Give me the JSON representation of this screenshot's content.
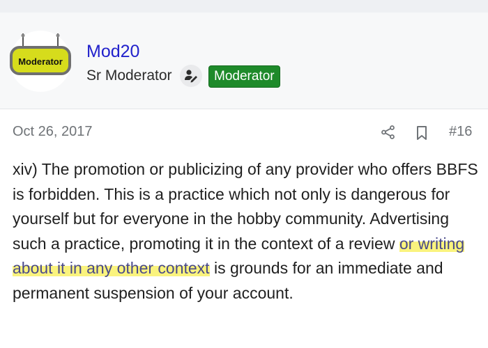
{
  "user": {
    "name": "Mod20",
    "title": "Sr Moderator",
    "badge": "Moderator",
    "avatar_text": "Moderator"
  },
  "post": {
    "date": "Oct 26, 2017",
    "number": "#16",
    "text_before": "xiv) The promotion or publicizing of any provider who offers BBFS is forbidden. This is a practice which not only is dangerous for yourself but for everyone in the hobby community. Advertising such a practice, promoting it in the context of a review ",
    "text_highlighted": "or writing about it in any other context",
    "text_after": " is grounds for an immediate and permanent suspension of your account."
  },
  "icons": {
    "share": "share-icon",
    "bookmark": "bookmark-icon",
    "staff": "staff-user-icon"
  },
  "colors": {
    "username": "#2222cc",
    "badge_bg": "#1e8a2a",
    "highlight": "#f8f05a"
  }
}
